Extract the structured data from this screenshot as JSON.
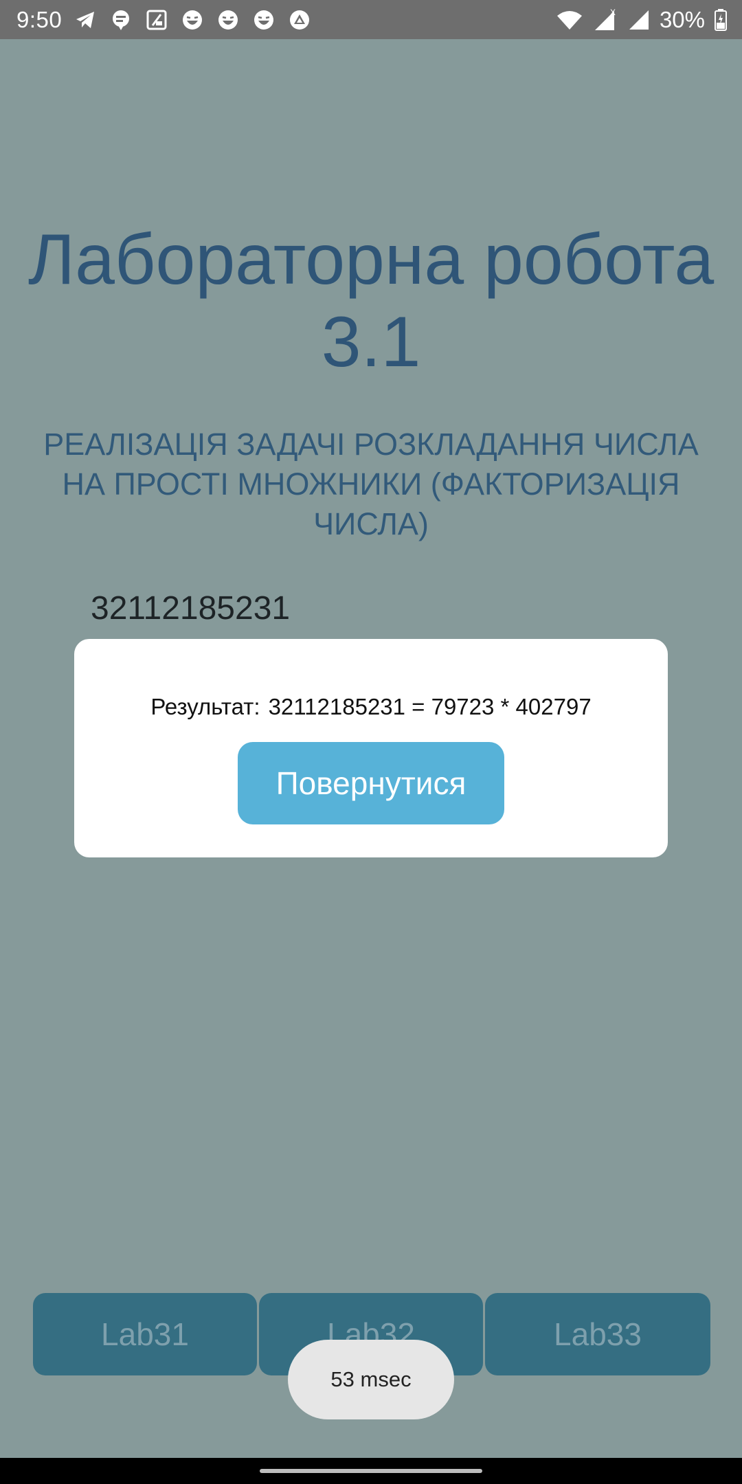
{
  "status_bar": {
    "time": "9:50",
    "notification_icons": [
      "telegram-icon",
      "chat-bubble-icon",
      "app-store-icon",
      "emoji-laugh-icon",
      "emoji-laugh-icon",
      "emoji-laugh-icon",
      "triangle-app-icon"
    ],
    "battery": "30%",
    "signal_x": "X"
  },
  "main": {
    "title_line1": "Лабораторна робота",
    "title_line2": "3.1",
    "subtitle": "РЕАЛІЗАЦІЯ ЗАДАЧІ РОЗКЛАДАННЯ ЧИСЛА НА ПРОСТІ МНОЖНИКИ (ФАКТОРИЗАЦІЯ ЧИСЛА)",
    "number_value": "32112185231"
  },
  "dialog": {
    "result_label": "Результат:",
    "result_expression": "32112185231 = 79723 * 402797",
    "return_button": "Повернутися"
  },
  "tabs": [
    {
      "label": "Lab31"
    },
    {
      "label": "Lab32"
    },
    {
      "label": "Lab33"
    }
  ],
  "toast": {
    "text": "53 msec"
  },
  "colors": {
    "background": "#869a9a",
    "title": "#2f5577",
    "dialog_button": "#57b2d8",
    "tab_button": "#356e82"
  }
}
